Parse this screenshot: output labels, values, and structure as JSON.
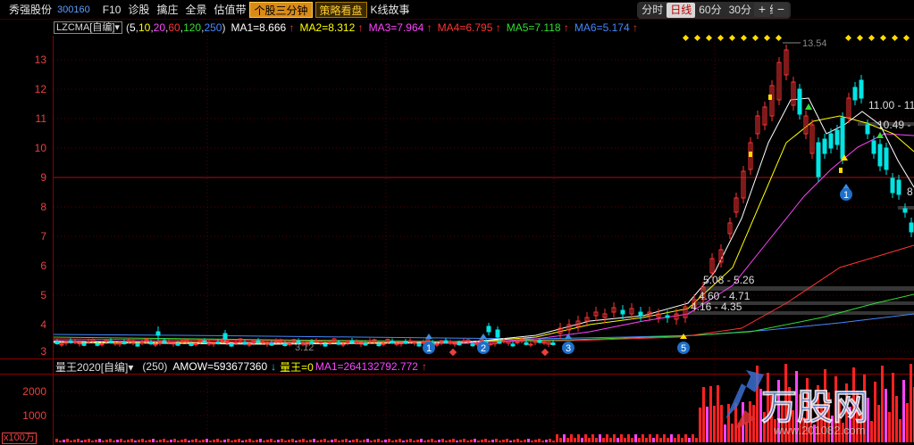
{
  "header": {
    "stock_name": "秀强股份",
    "stock_code": "300160",
    "tabs": [
      {
        "label": "F10"
      },
      {
        "label": "诊股"
      },
      {
        "label": "擒庄"
      },
      {
        "label": "全景"
      },
      {
        "label": "估值带"
      },
      {
        "label": "个股三分钟"
      },
      {
        "label": "策略看盘"
      },
      {
        "label": "K线故事"
      }
    ],
    "periods": [
      {
        "label": "分时"
      },
      {
        "label": "日线"
      },
      {
        "label": "60分"
      },
      {
        "label": "30分"
      },
      {
        "label": "周线"
      }
    ],
    "zoom_in": "+",
    "zoom_out": "−"
  },
  "indicator": {
    "name": "LZCMA[自编]",
    "params_open": "(",
    "params": [
      "5",
      "10",
      "20",
      "60",
      "120",
      "250"
    ],
    "params_close": ")",
    "values": [
      {
        "text": "MA1=8.666",
        "arrow": "↑"
      },
      {
        "text": "MA2=8.312",
        "arrow": "↑"
      },
      {
        "text": "MA3=7.964",
        "arrow": "↑"
      },
      {
        "text": "MA4=6.795",
        "arrow": "↑"
      },
      {
        "text": "MA5=7.118",
        "arrow": "↑"
      },
      {
        "text": "MA6=5.174",
        "arrow": "↑"
      }
    ],
    "colors": [
      "#ffffff",
      "#ffff00",
      "#ff44ff",
      "#ff3333",
      "#33dd33",
      "#4488ff"
    ]
  },
  "price_axis": [
    "13",
    "12",
    "11",
    "10",
    "9",
    "8",
    "7",
    "6",
    "5",
    "4",
    "3"
  ],
  "annotations": {
    "high": "13.54",
    "low": "3.12",
    "r1": "11.00 - 11",
    "r2": "10.49 -",
    "r3": "8",
    "r4": "5.08 - 5.26",
    "r5": "4.60 - 4.71",
    "r6": "4.16 - 4.35"
  },
  "markers": [
    "1",
    "2",
    "3",
    "5",
    "1"
  ],
  "volume": {
    "name": "量王2020[自编]",
    "param": "(250)",
    "amow": "AMOW=593677360",
    "amow_arrow": "↓",
    "lw": "量王=0",
    "ma1": "MA1=264132792.772",
    "ma1_arrow": "↑",
    "axis": [
      "2000",
      "1000"
    ],
    "unit": "x100万"
  },
  "watermark": {
    "brand": "万股网",
    "url": "www.201082.com"
  }
}
